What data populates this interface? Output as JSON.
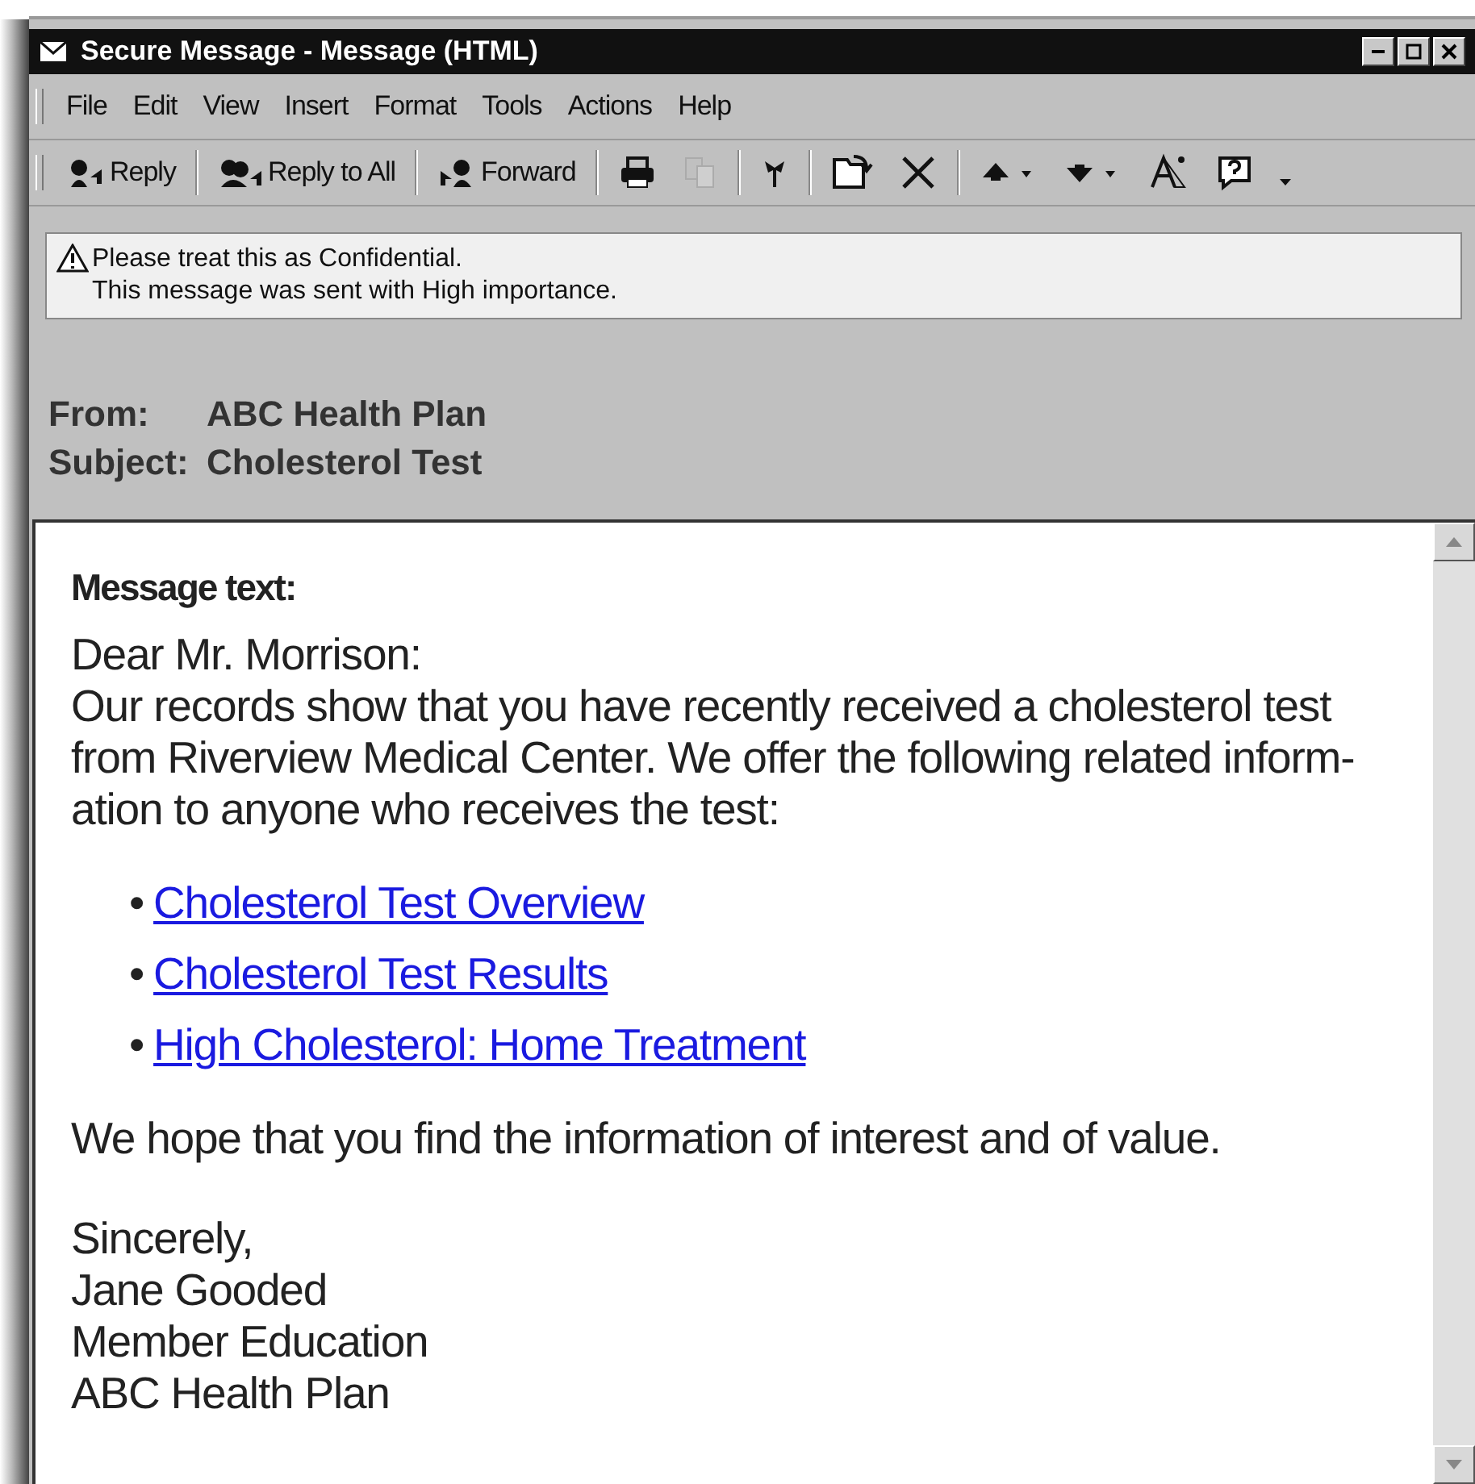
{
  "window": {
    "title": "Secure Message - Message (HTML)"
  },
  "menu": [
    "File",
    "Edit",
    "View",
    "Insert",
    "Format",
    "Tools",
    "Actions",
    "Help"
  ],
  "toolbar": [
    {
      "kind": "text",
      "label": "Reply"
    },
    {
      "kind": "text",
      "label": "Reply to All"
    },
    {
      "kind": "text",
      "label": "Forward"
    },
    {
      "kind": "icon",
      "disabled": false
    },
    {
      "kind": "icon",
      "disabled": true
    },
    {
      "kind": "icon",
      "disabled": false
    },
    {
      "kind": "icon",
      "disabled": false
    },
    {
      "kind": "icon",
      "disabled": false
    },
    {
      "kind": "drop",
      "disabled": false
    },
    {
      "kind": "drop",
      "disabled": false
    },
    {
      "kind": "icon",
      "disabled": false
    },
    {
      "kind": "icon",
      "disabled": false
    },
    {
      "kind": "caret"
    }
  ],
  "notice": [
    "Please treat this as Confidential.",
    "This message was sent with High importance."
  ],
  "header": [
    {
      "label": "From:",
      "value": "ABC Health Plan"
    },
    {
      "label": "Subject:",
      "value": "Cholesterol Test"
    }
  ],
  "body": {
    "heading": "Message text:",
    "greeting": "Dear Mr. Morrison:",
    "paragraph": [
      "Our records show that you have recently received a cholesterol test",
      "from Riverview Medical Center. We offer the following related inform-",
      "ation to anyone who receives the test:"
    ],
    "links": [
      {
        "bullet": "•",
        "text": "Cholesterol Test Overview"
      },
      {
        "bullet": "•",
        "text": "Cholesterol Test Results"
      },
      {
        "bullet": "•",
        "text": "High Cholesterol: Home Treatment"
      }
    ],
    "closing": "We hope that you find the information of interest and of value.",
    "signature": [
      "Sincerely,",
      "Jane Gooded",
      "Member Education",
      "ABC Health Plan"
    ]
  }
}
